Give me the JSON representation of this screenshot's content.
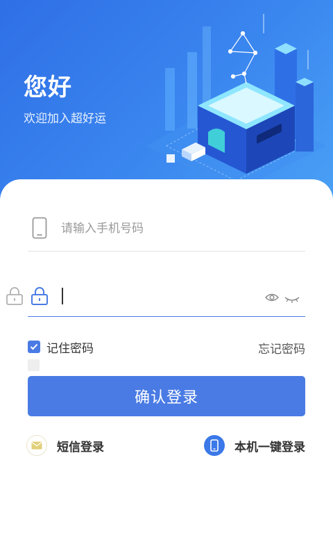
{
  "header": {
    "title": "您好",
    "subtitle": "欢迎加入超好运"
  },
  "login_form": {
    "phone_placeholder": "请输入手机号码",
    "phone_value": "",
    "password_value": "",
    "remember_label": "记住密码",
    "remember_checked": true,
    "forgot_label": "忘记密码",
    "confirm_label": "确认登录"
  },
  "alternate_login": {
    "sms_label": "短信登录",
    "onekey_label": "本机一键登录"
  },
  "colors": {
    "accent": "#4a7be4",
    "hero_gradient_start": "#2f6fe6",
    "hero_gradient_end": "#4aa0f5"
  },
  "icons": {
    "phone_field": "smartphone-icon",
    "password_field": "lock-icon",
    "show_password": "eye-icon",
    "hide_password": "eye-closed-icon",
    "sms": "envelope-icon",
    "onekey": "mobile-phone-icon"
  }
}
